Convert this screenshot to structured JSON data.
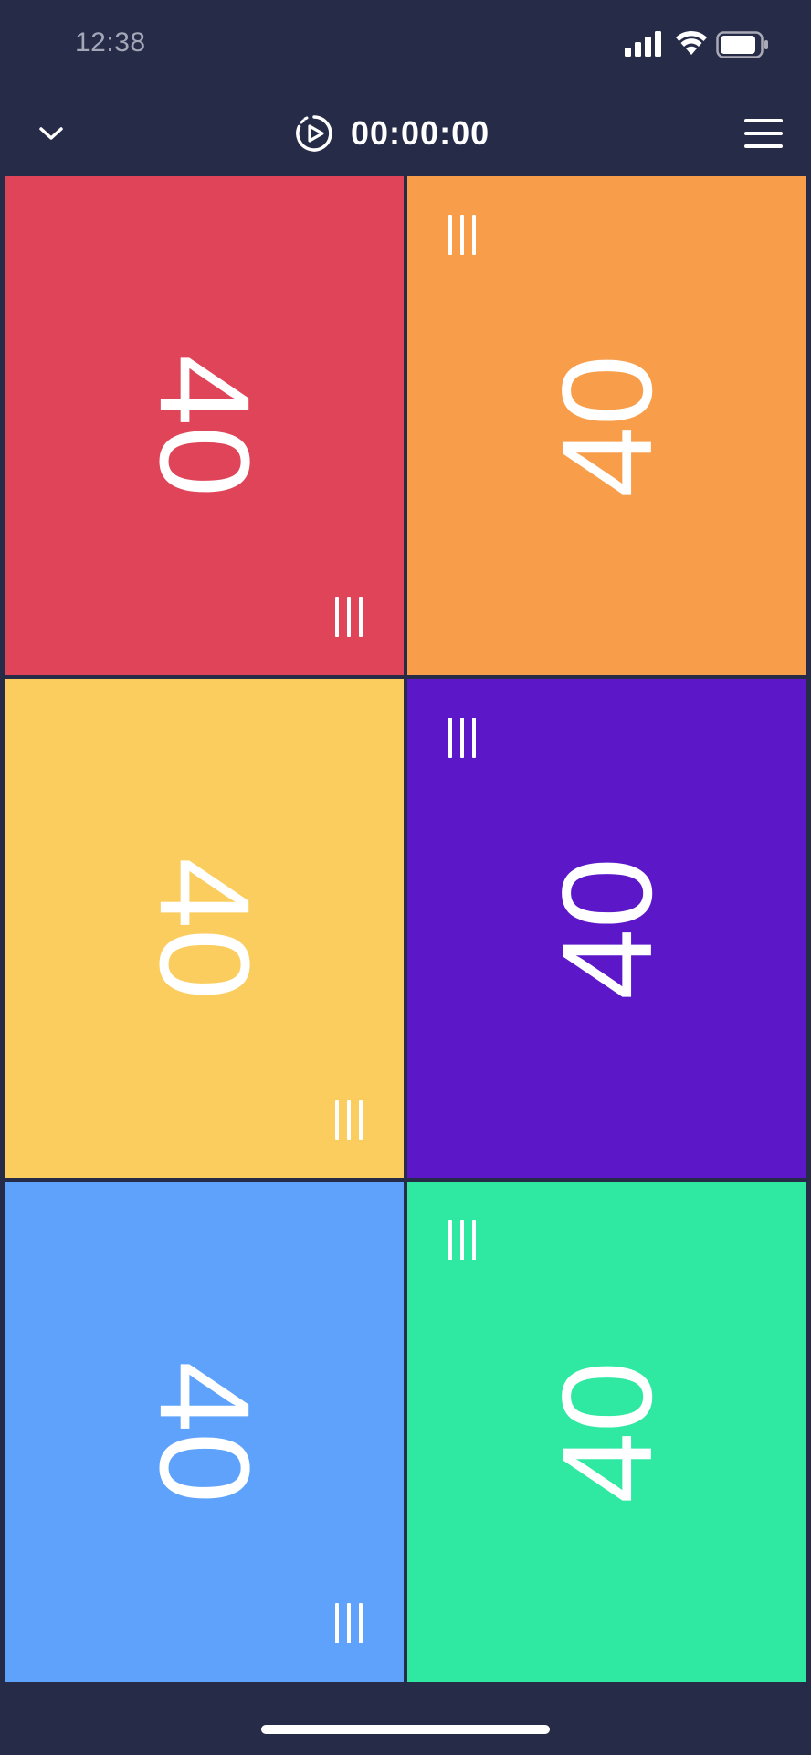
{
  "status_bar": {
    "time": "12:38",
    "icons": [
      "signal-icon",
      "wifi-icon",
      "battery-icon"
    ]
  },
  "header": {
    "collapse_icon": "chevron-down-icon",
    "timer_icon": "play-timer-icon",
    "timer": "00:00:00",
    "menu_icon": "hamburger-menu-icon"
  },
  "players": [
    {
      "life": "40",
      "color": "#e04458",
      "side": "left"
    },
    {
      "life": "40",
      "color": "#f89d4a",
      "side": "right"
    },
    {
      "life": "40",
      "color": "#fbcd5e",
      "side": "left"
    },
    {
      "life": "40",
      "color": "#5c17c9",
      "side": "right"
    },
    {
      "life": "40",
      "color": "#5ea2fc",
      "side": "left"
    },
    {
      "life": "40",
      "color": "#2fe8a2",
      "side": "right"
    }
  ],
  "colors": {
    "background": "#262c48",
    "text": "#ffffff",
    "status_time": "#a3a7b8"
  }
}
